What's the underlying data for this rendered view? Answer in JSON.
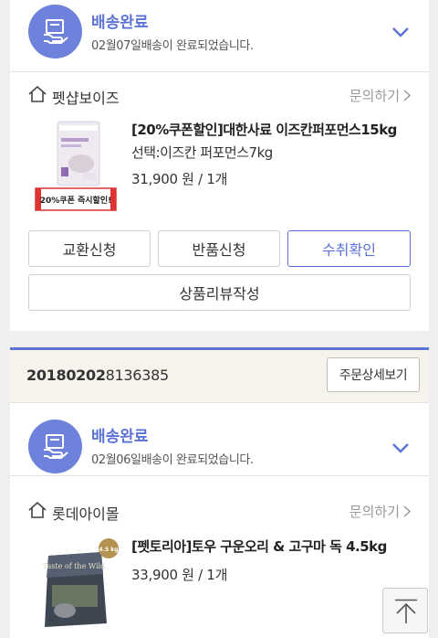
{
  "orders": [
    {
      "shipping": {
        "status": "배송완료",
        "date_text": "02월07일배송이 완료되었습니다."
      },
      "store": {
        "name": "펫샵보이즈",
        "inquiry_label": "문의하기"
      },
      "product": {
        "name": "[20%쿠폰할인]대한사료 이즈칸퍼포먼스15kg",
        "option": "선택:이즈칸 퍼포먼스7kg",
        "price": "31,900 원 / 1개",
        "thumb_badge": "20%쿠폰 즉시할인!"
      },
      "buttons": {
        "exchange": "교환신청",
        "return": "반품신청",
        "confirm": "수취확인",
        "review": "상품리뷰작성"
      }
    },
    {
      "order_number_bold": "20180202",
      "order_number_rest": "8136385",
      "detail_button": "주문상세보기",
      "shipping": {
        "status": "배송완료",
        "date_text": "02월06일배송이 완료되었습니다."
      },
      "store": {
        "name": "롯데아이몰",
        "inquiry_label": "문의하기"
      },
      "product": {
        "name": "[펫토리아]토우 구운오리 & 고구마 독 4.5kg",
        "price": "33,900 원 / 1개",
        "thumb_badge": "4.5 kg",
        "thumb_text": "Taste of the Wild"
      }
    }
  ],
  "colors": {
    "accent": "#5b73d6",
    "circle": "#6e82db",
    "order_bar_bg": "#f5f3ec"
  }
}
